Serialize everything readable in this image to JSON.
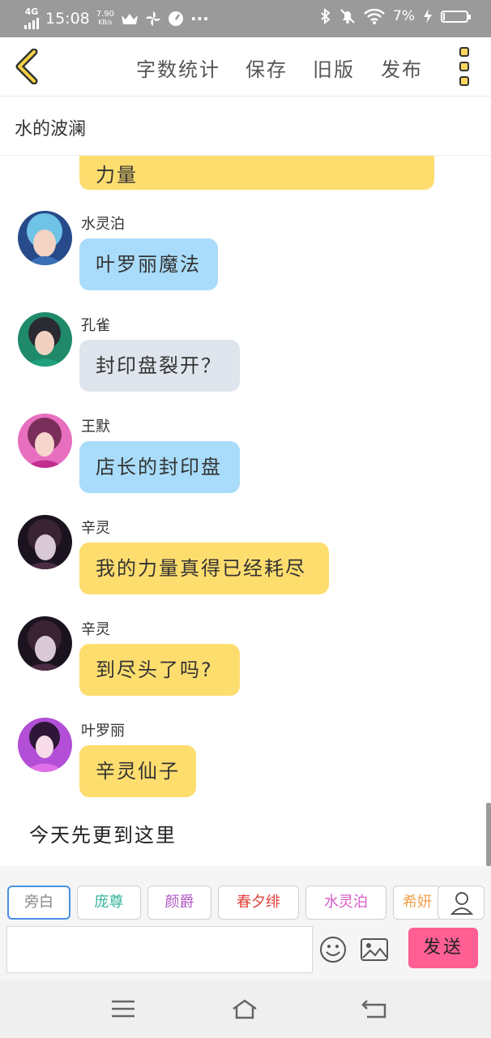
{
  "status_bar": {
    "network": "4G",
    "time": "15:08",
    "speed_value": "7.90",
    "speed_unit": "KB/s",
    "dots": "···",
    "battery_text": "7%",
    "battery_level": 0.07
  },
  "top_bar": {
    "menu": [
      "字数统计",
      "保存",
      "旧版",
      "发布"
    ]
  },
  "title_bar": {
    "title": "水的波澜"
  },
  "chat": {
    "first_bubble": "力量",
    "messages": [
      {
        "name": "水灵泊",
        "text": "叶罗丽魔法",
        "color": "blue"
      },
      {
        "name": "孔雀",
        "text": "封印盘裂开？",
        "color": "grey"
      },
      {
        "name": "王默",
        "text": "店长的封印盘",
        "color": "blue"
      },
      {
        "name": "辛灵",
        "text": "我的力量真得已经耗尽",
        "color": "yellow"
      },
      {
        "name": "辛灵",
        "text": "到尽头了吗?",
        "color": "yellow"
      },
      {
        "name": "叶罗丽",
        "text": "辛灵仙子",
        "color": "yellow"
      }
    ],
    "narration": "今天先更到这里"
  },
  "chips": [
    {
      "label": "旁白",
      "color": "#8a8a8a"
    },
    {
      "label": "庞尊",
      "color": "#35b59a"
    },
    {
      "label": "颜爵",
      "color": "#b05ac4"
    },
    {
      "label": "春夕绯",
      "color": "#e0433c"
    },
    {
      "label": "水灵泊",
      "color": "#d45cc8"
    },
    {
      "label": "希妍",
      "color": "#f0a04b"
    }
  ],
  "compose": {
    "input_value": "",
    "send_label": "发送"
  },
  "colors": {
    "bubble_yellow": "#fedd6f",
    "bubble_blue": "#a9dcfa",
    "bubble_grey": "#dfe5ec",
    "send_button": "#ff5f93",
    "active_chip_border": "#4a90e2"
  }
}
